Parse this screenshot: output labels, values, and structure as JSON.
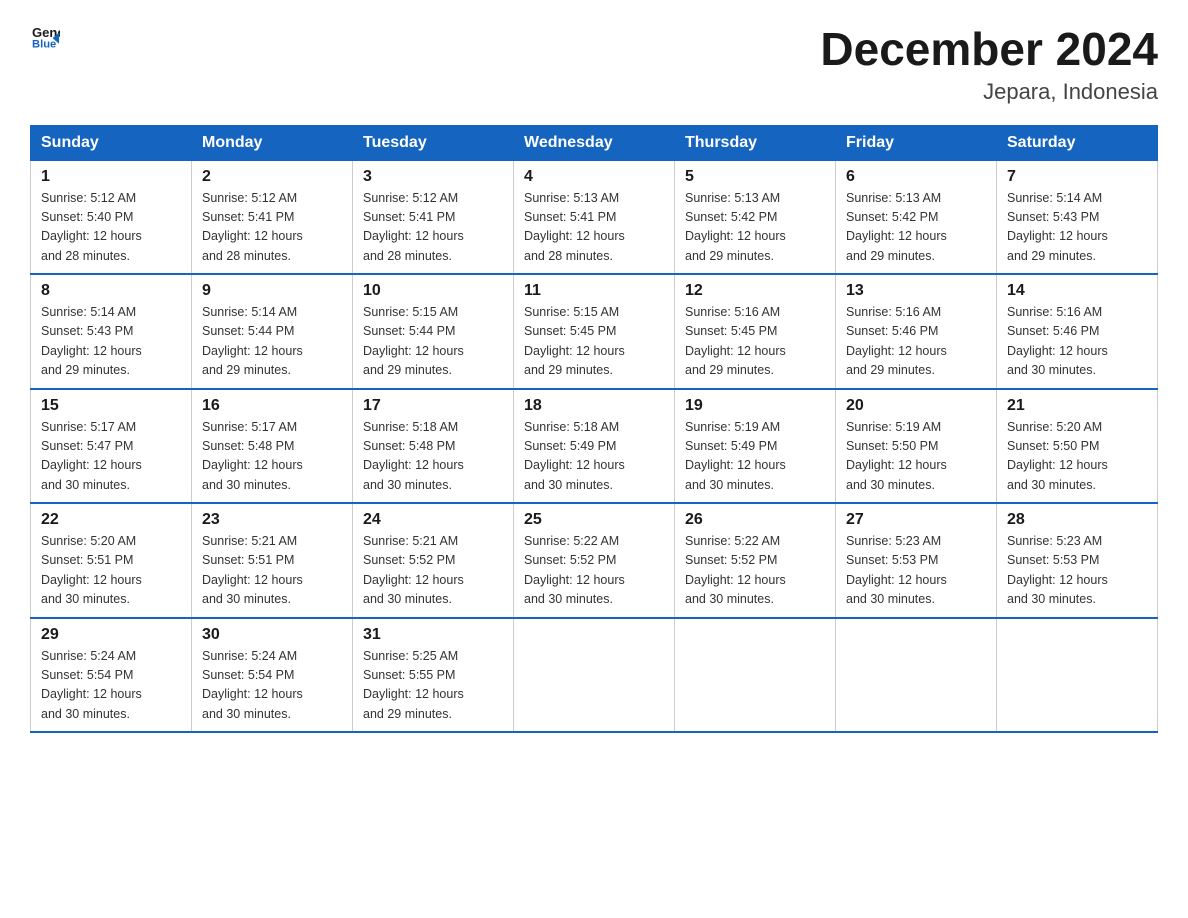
{
  "logo": {
    "general": "General",
    "blue": "Blue"
  },
  "title": "December 2024",
  "subtitle": "Jepara, Indonesia",
  "headers": [
    "Sunday",
    "Monday",
    "Tuesday",
    "Wednesday",
    "Thursday",
    "Friday",
    "Saturday"
  ],
  "weeks": [
    [
      {
        "day": "1",
        "sunrise": "5:12 AM",
        "sunset": "5:40 PM",
        "daylight": "12 hours and 28 minutes."
      },
      {
        "day": "2",
        "sunrise": "5:12 AM",
        "sunset": "5:41 PM",
        "daylight": "12 hours and 28 minutes."
      },
      {
        "day": "3",
        "sunrise": "5:12 AM",
        "sunset": "5:41 PM",
        "daylight": "12 hours and 28 minutes."
      },
      {
        "day": "4",
        "sunrise": "5:13 AM",
        "sunset": "5:41 PM",
        "daylight": "12 hours and 28 minutes."
      },
      {
        "day": "5",
        "sunrise": "5:13 AM",
        "sunset": "5:42 PM",
        "daylight": "12 hours and 29 minutes."
      },
      {
        "day": "6",
        "sunrise": "5:13 AM",
        "sunset": "5:42 PM",
        "daylight": "12 hours and 29 minutes."
      },
      {
        "day": "7",
        "sunrise": "5:14 AM",
        "sunset": "5:43 PM",
        "daylight": "12 hours and 29 minutes."
      }
    ],
    [
      {
        "day": "8",
        "sunrise": "5:14 AM",
        "sunset": "5:43 PM",
        "daylight": "12 hours and 29 minutes."
      },
      {
        "day": "9",
        "sunrise": "5:14 AM",
        "sunset": "5:44 PM",
        "daylight": "12 hours and 29 minutes."
      },
      {
        "day": "10",
        "sunrise": "5:15 AM",
        "sunset": "5:44 PM",
        "daylight": "12 hours and 29 minutes."
      },
      {
        "day": "11",
        "sunrise": "5:15 AM",
        "sunset": "5:45 PM",
        "daylight": "12 hours and 29 minutes."
      },
      {
        "day": "12",
        "sunrise": "5:16 AM",
        "sunset": "5:45 PM",
        "daylight": "12 hours and 29 minutes."
      },
      {
        "day": "13",
        "sunrise": "5:16 AM",
        "sunset": "5:46 PM",
        "daylight": "12 hours and 29 minutes."
      },
      {
        "day": "14",
        "sunrise": "5:16 AM",
        "sunset": "5:46 PM",
        "daylight": "12 hours and 30 minutes."
      }
    ],
    [
      {
        "day": "15",
        "sunrise": "5:17 AM",
        "sunset": "5:47 PM",
        "daylight": "12 hours and 30 minutes."
      },
      {
        "day": "16",
        "sunrise": "5:17 AM",
        "sunset": "5:48 PM",
        "daylight": "12 hours and 30 minutes."
      },
      {
        "day": "17",
        "sunrise": "5:18 AM",
        "sunset": "5:48 PM",
        "daylight": "12 hours and 30 minutes."
      },
      {
        "day": "18",
        "sunrise": "5:18 AM",
        "sunset": "5:49 PM",
        "daylight": "12 hours and 30 minutes."
      },
      {
        "day": "19",
        "sunrise": "5:19 AM",
        "sunset": "5:49 PM",
        "daylight": "12 hours and 30 minutes."
      },
      {
        "day": "20",
        "sunrise": "5:19 AM",
        "sunset": "5:50 PM",
        "daylight": "12 hours and 30 minutes."
      },
      {
        "day": "21",
        "sunrise": "5:20 AM",
        "sunset": "5:50 PM",
        "daylight": "12 hours and 30 minutes."
      }
    ],
    [
      {
        "day": "22",
        "sunrise": "5:20 AM",
        "sunset": "5:51 PM",
        "daylight": "12 hours and 30 minutes."
      },
      {
        "day": "23",
        "sunrise": "5:21 AM",
        "sunset": "5:51 PM",
        "daylight": "12 hours and 30 minutes."
      },
      {
        "day": "24",
        "sunrise": "5:21 AM",
        "sunset": "5:52 PM",
        "daylight": "12 hours and 30 minutes."
      },
      {
        "day": "25",
        "sunrise": "5:22 AM",
        "sunset": "5:52 PM",
        "daylight": "12 hours and 30 minutes."
      },
      {
        "day": "26",
        "sunrise": "5:22 AM",
        "sunset": "5:52 PM",
        "daylight": "12 hours and 30 minutes."
      },
      {
        "day": "27",
        "sunrise": "5:23 AM",
        "sunset": "5:53 PM",
        "daylight": "12 hours and 30 minutes."
      },
      {
        "day": "28",
        "sunrise": "5:23 AM",
        "sunset": "5:53 PM",
        "daylight": "12 hours and 30 minutes."
      }
    ],
    [
      {
        "day": "29",
        "sunrise": "5:24 AM",
        "sunset": "5:54 PM",
        "daylight": "12 hours and 30 minutes."
      },
      {
        "day": "30",
        "sunrise": "5:24 AM",
        "sunset": "5:54 PM",
        "daylight": "12 hours and 30 minutes."
      },
      {
        "day": "31",
        "sunrise": "5:25 AM",
        "sunset": "5:55 PM",
        "daylight": "12 hours and 29 minutes."
      },
      null,
      null,
      null,
      null
    ]
  ],
  "labels": {
    "sunrise": "Sunrise:",
    "sunset": "Sunset:",
    "daylight": "Daylight:"
  }
}
